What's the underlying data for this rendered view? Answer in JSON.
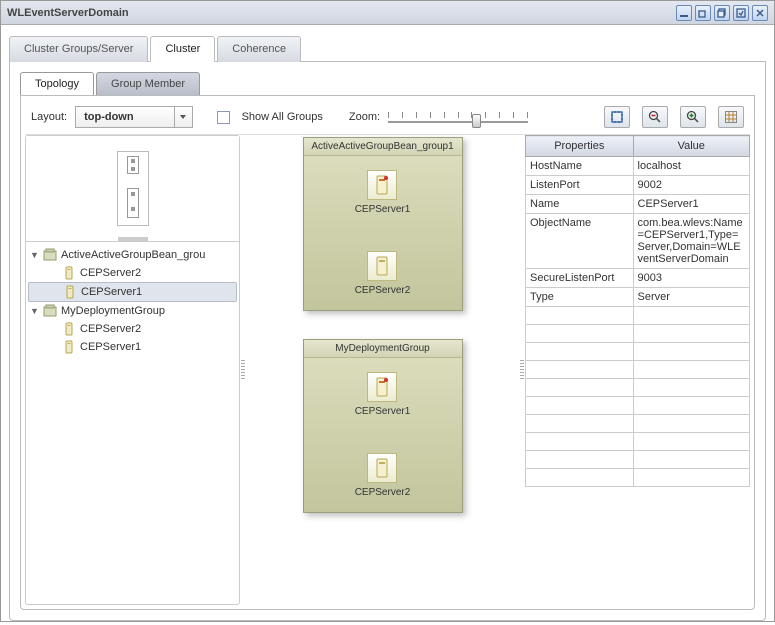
{
  "window": {
    "title": "WLEventServerDomain"
  },
  "mainTabs": [
    {
      "label": "Cluster Groups/Server",
      "active": false
    },
    {
      "label": "Cluster",
      "active": true
    },
    {
      "label": "Coherence",
      "active": false
    }
  ],
  "subTabs": [
    {
      "label": "Topology",
      "active": true
    },
    {
      "label": "Group Member",
      "active": false
    }
  ],
  "toolbar": {
    "layoutLabel": "Layout:",
    "layoutValue": "top-down",
    "showAllLabel": "Show All Groups",
    "zoomLabel": "Zoom:"
  },
  "tree": [
    {
      "type": "group",
      "label": "ActiveActiveGroupBean_grou",
      "children": [
        {
          "label": "CEPServer2",
          "selected": false
        },
        {
          "label": "CEPServer1",
          "selected": true
        }
      ]
    },
    {
      "type": "group",
      "label": "MyDeploymentGroup",
      "children": [
        {
          "label": "CEPServer2",
          "selected": false
        },
        {
          "label": "CEPServer1",
          "selected": false
        }
      ]
    }
  ],
  "canvasGroups": [
    {
      "title": "ActiveActiveGroupBean_group1",
      "nodes": [
        "CEPServer1",
        "CEPServer2"
      ]
    },
    {
      "title": "MyDeploymentGroup",
      "nodes": [
        "CEPServer1",
        "CEPServer2"
      ]
    }
  ],
  "properties": {
    "headers": [
      "Properties",
      "Value"
    ],
    "rows": [
      {
        "k": "HostName",
        "v": "localhost"
      },
      {
        "k": "ListenPort",
        "v": "9002"
      },
      {
        "k": "Name",
        "v": "CEPServer1"
      },
      {
        "k": "ObjectName",
        "v": "com.bea.wlevs:Name=CEPServer1,Type=Server,Domain=WLEventServerDomain"
      },
      {
        "k": "SecureListenPort",
        "v": "9003"
      },
      {
        "k": "Type",
        "v": "Server"
      }
    ],
    "emptyRows": 10
  }
}
